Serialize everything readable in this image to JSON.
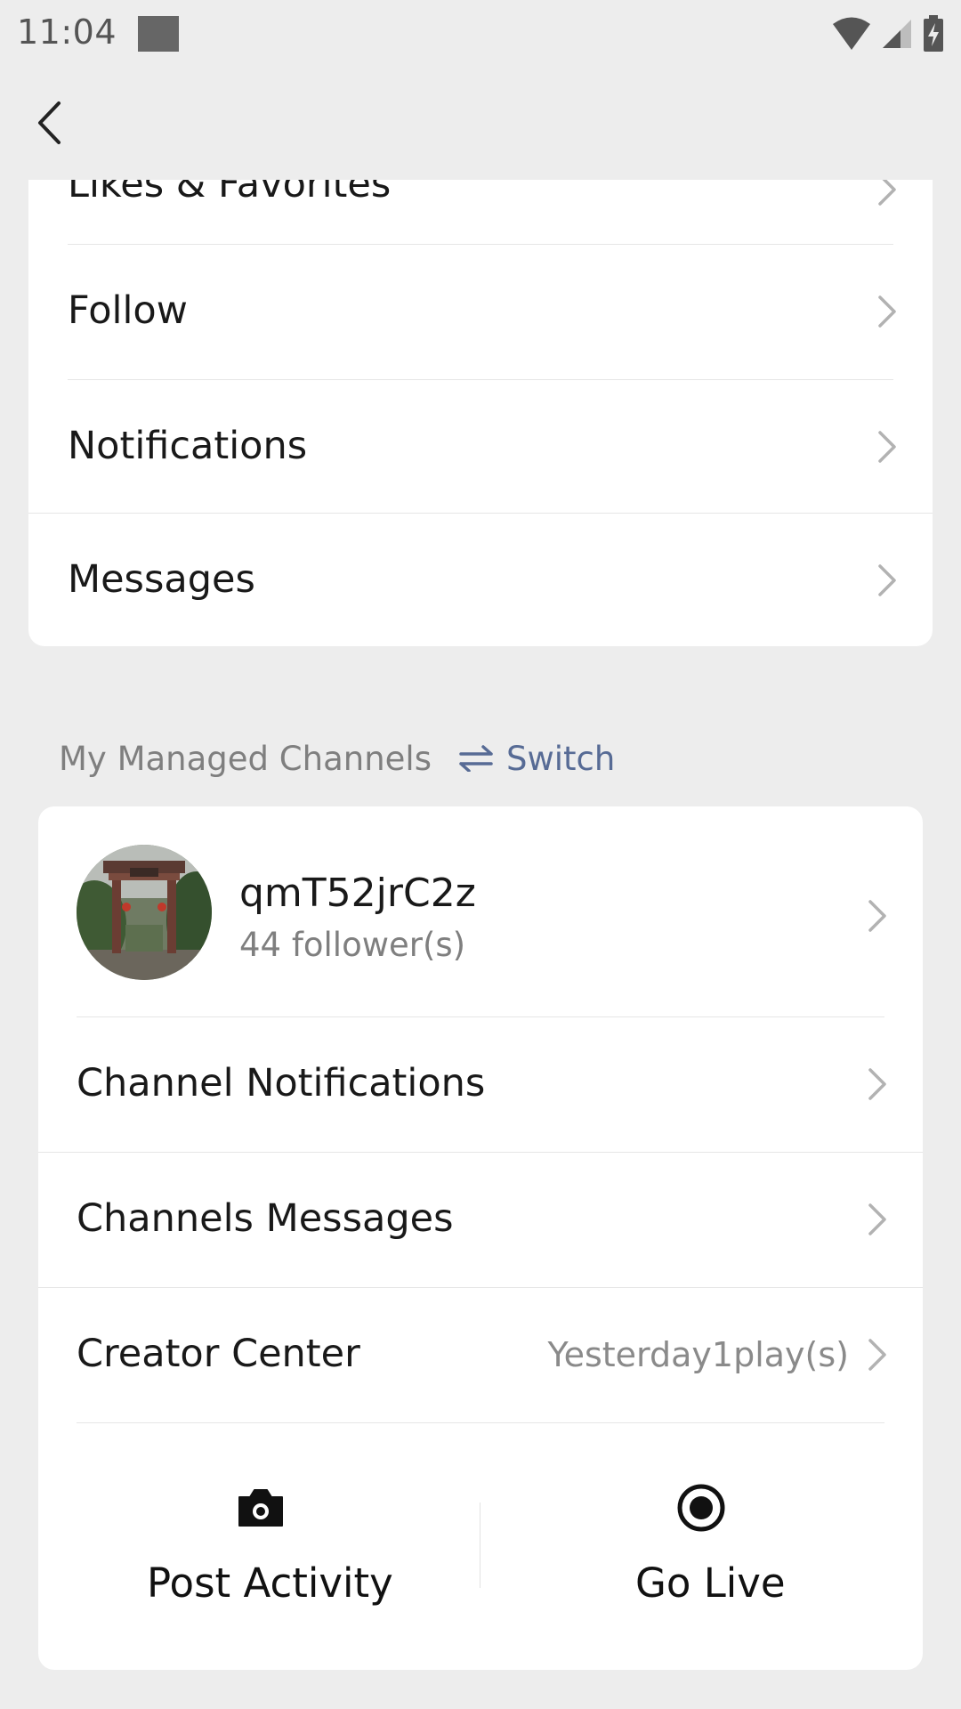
{
  "status_bar": {
    "time": "11:04"
  },
  "nav": {
    "back_icon": "chevron-left-icon"
  },
  "menu": {
    "items": [
      {
        "label": "Likes & Favorites"
      },
      {
        "label": "Follow"
      },
      {
        "label": "Notifications"
      },
      {
        "label": "Messages"
      }
    ]
  },
  "managed_channels": {
    "title": "My Managed Channels",
    "switch_label": "Switch",
    "switch_icon": "swap-arrows-icon",
    "channel": {
      "name": "qmT52jrC2z",
      "followers": "44 follower(s)"
    },
    "items": [
      {
        "label": "Channel Notifications",
        "value": ""
      },
      {
        "label": "Channels Messages",
        "value": ""
      },
      {
        "label": "Creator Center",
        "value": "Yesterday1play(s)"
      }
    ],
    "actions": [
      {
        "label": "Post Activity",
        "icon": "camera-icon"
      },
      {
        "label": "Go Live",
        "icon": "record-icon"
      }
    ]
  },
  "colors": {
    "background": "#ededed",
    "card": "#ffffff",
    "link": "#576b95",
    "secondary_text": "#7f7f7f"
  }
}
